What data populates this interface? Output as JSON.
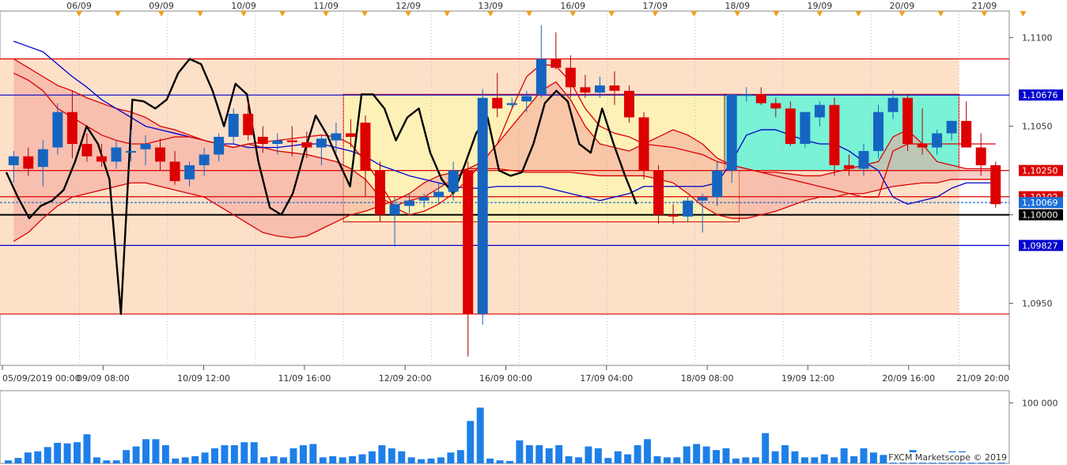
{
  "chart_data": {
    "type": "candlestick",
    "instrument_panel": {
      "top_date_ticks": [
        "06/09",
        "09/09",
        "10/09",
        "11/09",
        "12/09",
        "13/09",
        "16/09",
        "17/09",
        "18/09",
        "19/09",
        "20/09",
        "21/09"
      ],
      "bottom_time_ticks": [
        "05/09/2019 00:00",
        "09/09 08:00",
        "10/09 12:00",
        "11/09 16:00",
        "12/09 20:00",
        "16/09 00:00",
        "17/09 04:00",
        "18/09 08:00",
        "19/09 12:00",
        "20/09 16:00",
        "21/09 20:00"
      ],
      "y_ticks": [
        "1,0950",
        "1,1000",
        "1,1050",
        "1,1100"
      ],
      "ylim": [
        1.0915,
        1.1115
      ],
      "price_tags": [
        {
          "label": "1,10676",
          "value": 1.10676,
          "bg": "#0000cc",
          "fg": "#ffffff"
        },
        {
          "label": "1,10250",
          "value": 1.1025,
          "bg": "#dd0000",
          "fg": "#ffffff"
        },
        {
          "label": "1,10102",
          "value": 1.10102,
          "bg": "#dd0000",
          "fg": "#ffffff"
        },
        {
          "label": "1,10069",
          "value": 1.10069,
          "bg": "#1e6fd9",
          "fg": "#ffffff"
        },
        {
          "label": "1,10000",
          "value": 1.1,
          "bg": "#000000",
          "fg": "#ffffff"
        },
        {
          "label": "1,09827",
          "value": 1.09827,
          "bg": "#0000cc",
          "fg": "#ffffff"
        }
      ],
      "horizontal_lines": [
        {
          "value": 1.1088,
          "color": "#dd0000"
        },
        {
          "value": 1.10676,
          "color": "#0000cc"
        },
        {
          "value": 1.1025,
          "color": "#dd0000"
        },
        {
          "value": 1.10102,
          "color": "#dd0000"
        },
        {
          "value": 1.10069,
          "color": "#1e6fd9",
          "dashed": true
        },
        {
          "value": 1.1,
          "color": "#000000"
        },
        {
          "value": 1.09827,
          "color": "#0000cc"
        },
        {
          "value": 1.0944,
          "color": "#dd0000"
        }
      ],
      "zones": [
        {
          "from_bar": 0,
          "to_bar": 64,
          "low": 1.0944,
          "high": 1.1088,
          "color": "#fde0c8"
        },
        {
          "from_bar": 23,
          "to_bar": 49,
          "low": 1.0996,
          "high": 1.1068,
          "color": "#fdf1b8"
        },
        {
          "from_bar": 49,
          "to_bar": 64,
          "low": 1.1025,
          "high": 1.1068,
          "color": "#79f2d6"
        }
      ],
      "candles": [
        {
          "o": 1.1028,
          "h": 1.1036,
          "l": 1.1018,
          "c": 1.1033
        },
        {
          "o": 1.1033,
          "h": 1.1038,
          "l": 1.1022,
          "c": 1.1026
        },
        {
          "o": 1.1027,
          "h": 1.1042,
          "l": 1.1016,
          "c": 1.1037
        },
        {
          "o": 1.1038,
          "h": 1.1063,
          "l": 1.1034,
          "c": 1.1058
        },
        {
          "o": 1.1058,
          "h": 1.107,
          "l": 1.1032,
          "c": 1.104
        },
        {
          "o": 1.104,
          "h": 1.1046,
          "l": 1.103,
          "c": 1.1033
        },
        {
          "o": 1.1033,
          "h": 1.104,
          "l": 1.1027,
          "c": 1.103
        },
        {
          "o": 1.103,
          "h": 1.1042,
          "l": 1.1026,
          "c": 1.1038
        },
        {
          "o": 1.1036,
          "h": 1.1048,
          "l": 1.103,
          "c": 1.1036
        },
        {
          "o": 1.1037,
          "h": 1.1045,
          "l": 1.1028,
          "c": 1.104
        },
        {
          "o": 1.1038,
          "h": 1.1043,
          "l": 1.1025,
          "c": 1.103
        },
        {
          "o": 1.103,
          "h": 1.1036,
          "l": 1.1017,
          "c": 1.1019
        },
        {
          "o": 1.102,
          "h": 1.103,
          "l": 1.1016,
          "c": 1.1028
        },
        {
          "o": 1.1028,
          "h": 1.1038,
          "l": 1.1022,
          "c": 1.1034
        },
        {
          "o": 1.1034,
          "h": 1.1046,
          "l": 1.103,
          "c": 1.1044
        },
        {
          "o": 1.1044,
          "h": 1.106,
          "l": 1.104,
          "c": 1.1057
        },
        {
          "o": 1.1057,
          "h": 1.1064,
          "l": 1.1042,
          "c": 1.1045
        },
        {
          "o": 1.1044,
          "h": 1.105,
          "l": 1.1035,
          "c": 1.104
        },
        {
          "o": 1.104,
          "h": 1.1046,
          "l": 1.1034,
          "c": 1.1042
        },
        {
          "o": 1.1042,
          "h": 1.105,
          "l": 1.1033,
          "c": 1.1041
        },
        {
          "o": 1.1041,
          "h": 1.1047,
          "l": 1.1032,
          "c": 1.1038
        },
        {
          "o": 1.1038,
          "h": 1.1045,
          "l": 1.1028,
          "c": 1.1043
        },
        {
          "o": 1.1042,
          "h": 1.1052,
          "l": 1.1035,
          "c": 1.1046
        },
        {
          "o": 1.1046,
          "h": 1.1054,
          "l": 1.1038,
          "c": 1.1044
        },
        {
          "o": 1.1052,
          "h": 1.1056,
          "l": 1.101,
          "c": 1.1025
        },
        {
          "o": 1.1025,
          "h": 1.103,
          "l": 1.0996,
          "c": 1.1
        },
        {
          "o": 1.1,
          "h": 1.101,
          "l": 1.0982,
          "c": 1.1006
        },
        {
          "o": 1.1005,
          "h": 1.1012,
          "l": 1.1,
          "c": 1.1008
        },
        {
          "o": 1.1008,
          "h": 1.1012,
          "l": 1.1004,
          "c": 1.101
        },
        {
          "o": 1.101,
          "h": 1.1018,
          "l": 1.1006,
          "c": 1.1013
        },
        {
          "o": 1.1013,
          "h": 1.103,
          "l": 1.1008,
          "c": 1.1025
        },
        {
          "o": 1.1025,
          "h": 1.103,
          "l": 1.092,
          "c": 1.0944
        },
        {
          "o": 1.0944,
          "h": 1.1071,
          "l": 1.0938,
          "c": 1.1066
        },
        {
          "o": 1.1066,
          "h": 1.108,
          "l": 1.1055,
          "c": 1.106
        },
        {
          "o": 1.1062,
          "h": 1.1066,
          "l": 1.106,
          "c": 1.1063
        },
        {
          "o": 1.1064,
          "h": 1.107,
          "l": 1.1058,
          "c": 1.1067
        },
        {
          "o": 1.1068,
          "h": 1.1107,
          "l": 1.1066,
          "c": 1.1088
        },
        {
          "o": 1.1088,
          "h": 1.1103,
          "l": 1.1082,
          "c": 1.1083
        },
        {
          "o": 1.1083,
          "h": 1.109,
          "l": 1.1066,
          "c": 1.1072
        },
        {
          "o": 1.1072,
          "h": 1.1079,
          "l": 1.1066,
          "c": 1.1069
        },
        {
          "o": 1.1069,
          "h": 1.1078,
          "l": 1.1066,
          "c": 1.1073
        },
        {
          "o": 1.1073,
          "h": 1.1081,
          "l": 1.1062,
          "c": 1.107
        },
        {
          "o": 1.107,
          "h": 1.1073,
          "l": 1.1052,
          "c": 1.1055
        },
        {
          "o": 1.1055,
          "h": 1.1058,
          "l": 1.102,
          "c": 1.1025
        },
        {
          "o": 1.1025,
          "h": 1.1028,
          "l": 1.0995,
          "c": 1.1
        },
        {
          "o": 1.1,
          "h": 1.1006,
          "l": 1.0995,
          "c": 1.0999
        },
        {
          "o": 1.0999,
          "h": 1.101,
          "l": 1.0996,
          "c": 1.1008
        },
        {
          "o": 1.1008,
          "h": 1.1012,
          "l": 1.099,
          "c": 1.101
        },
        {
          "o": 1.101,
          "h": 1.103,
          "l": 1.1005,
          "c": 1.1025
        },
        {
          "o": 1.1025,
          "h": 1.103,
          "l": 1.1018,
          "c": 1.1068
        },
        {
          "o": 1.1068,
          "h": 1.1072,
          "l": 1.1064,
          "c": 1.1068
        },
        {
          "o": 1.1068,
          "h": 1.1072,
          "l": 1.1062,
          "c": 1.1063
        },
        {
          "o": 1.1063,
          "h": 1.1066,
          "l": 1.1055,
          "c": 1.106
        },
        {
          "o": 1.106,
          "h": 1.1064,
          "l": 1.1039,
          "c": 1.104
        },
        {
          "o": 1.104,
          "h": 1.1058,
          "l": 1.1038,
          "c": 1.1058
        },
        {
          "o": 1.1055,
          "h": 1.1064,
          "l": 1.105,
          "c": 1.1062
        },
        {
          "o": 1.1062,
          "h": 1.1066,
          "l": 1.1022,
          "c": 1.1028
        },
        {
          "o": 1.1028,
          "h": 1.1034,
          "l": 1.1022,
          "c": 1.1026
        },
        {
          "o": 1.1026,
          "h": 1.104,
          "l": 1.1022,
          "c": 1.1036
        },
        {
          "o": 1.1036,
          "h": 1.1062,
          "l": 1.1032,
          "c": 1.1058
        },
        {
          "o": 1.1058,
          "h": 1.107,
          "l": 1.1054,
          "c": 1.1066
        },
        {
          "o": 1.1066,
          "h": 1.1068,
          "l": 1.1036,
          "c": 1.104
        },
        {
          "o": 1.104,
          "h": 1.106,
          "l": 1.1034,
          "c": 1.1038
        },
        {
          "o": 1.1038,
          "h": 1.1048,
          "l": 1.1034,
          "c": 1.1046
        },
        {
          "o": 1.1046,
          "h": 1.1053,
          "l": 1.1042,
          "c": 1.1053
        },
        {
          "o": 1.1053,
          "h": 1.1064,
          "l": 1.104,
          "c": 1.1038
        },
        {
          "o": 1.1038,
          "h": 1.1046,
          "l": 1.1022,
          "c": 1.1028
        },
        {
          "o": 1.1028,
          "h": 1.103,
          "l": 1.1004,
          "c": 1.1006
        }
      ],
      "overlay_lines": {
        "black_oscillator": [
          1.1024,
          1.101,
          1.0998,
          1.1005,
          1.1008,
          1.1014,
          1.103,
          1.105,
          1.104,
          1.102,
          1.0944,
          1.1065,
          1.1064,
          1.106,
          1.1065,
          1.108,
          1.1088,
          1.1085,
          1.107,
          1.105,
          1.1074,
          1.1068,
          1.103,
          1.1004,
          1.1,
          1.1012,
          1.1035,
          1.1056,
          1.1045,
          1.103,
          1.1016,
          1.1068,
          1.1068,
          1.106,
          1.1042,
          1.1055,
          1.106,
          1.1035,
          1.102,
          1.1012,
          1.1028,
          1.1046,
          1.1055,
          1.1025,
          1.1022,
          1.1024,
          1.104,
          1.1063,
          1.107,
          1.1064,
          1.104,
          1.1035,
          1.106,
          1.104,
          1.1022,
          1.1006
        ],
        "red_cloud_upper": [
          1.1088,
          1.1083,
          1.1078,
          1.1073,
          1.107,
          1.1066,
          1.1063,
          1.106,
          1.1058,
          1.1055,
          1.105,
          1.1048,
          1.1045,
          1.1042,
          1.104,
          1.1038,
          1.104,
          1.1038,
          1.1036,
          1.1035,
          1.1034,
          1.1032,
          1.103,
          1.1026,
          1.102,
          1.101,
          1.1005,
          1.1008,
          1.101,
          1.1015,
          1.102,
          1.1026,
          1.103,
          1.104,
          1.105,
          1.106,
          1.107,
          1.1075,
          1.1065,
          1.105,
          1.104,
          1.1038,
          1.1036,
          1.104,
          1.1044,
          1.1048,
          1.1045,
          1.104,
          1.1032,
          1.1028,
          1.1026,
          1.1024,
          1.1024,
          1.1023,
          1.1022,
          1.1022,
          1.1024,
          1.1026,
          1.1028,
          1.103,
          1.1044,
          1.1048,
          1.104,
          1.103,
          1.1028,
          1.1026,
          1.1026,
          1.1026
        ],
        "red_cloud_lower": [
          1.0985,
          1.099,
          1.0998,
          1.1005,
          1.101,
          1.1012,
          1.1014,
          1.1016,
          1.1018,
          1.1018,
          1.1016,
          1.1014,
          1.1012,
          1.101,
          1.1005,
          1.1,
          1.0995,
          1.099,
          1.0988,
          1.0987,
          1.0988,
          1.0992,
          1.0996,
          1.1,
          1.1002,
          1.1005,
          1.1008,
          1.1012,
          1.1018,
          1.1022,
          1.1024,
          1.1026,
          1.1026,
          1.1026,
          1.1025,
          1.1024,
          1.1024,
          1.1024,
          1.1024,
          1.1023,
          1.1022,
          1.1022,
          1.1022,
          1.1022,
          1.102,
          1.1018,
          1.1012,
          1.1005,
          1.1,
          1.0998,
          1.0998,
          1.1,
          1.1002,
          1.1005,
          1.1008,
          1.101,
          1.101,
          1.1012,
          1.1012,
          1.1014,
          1.1016,
          1.1017,
          1.1018,
          1.1018,
          1.102,
          1.102,
          1.102,
          1.102
        ],
        "blue_kijun": [
          1.1098,
          1.1095,
          1.1092,
          1.1085,
          1.1078,
          1.1072,
          1.1065,
          1.106,
          1.1055,
          1.105,
          1.1048,
          1.1046,
          1.1044,
          1.1042,
          1.104,
          1.104,
          1.1038,
          1.1038,
          1.1038,
          1.1039,
          1.104,
          1.104,
          1.1038,
          1.1036,
          1.1033,
          1.1028,
          1.1025,
          1.1022,
          1.102,
          1.1018,
          1.1016,
          1.1015,
          1.1015,
          1.1016,
          1.1016,
          1.1016,
          1.1016,
          1.1014,
          1.1012,
          1.101,
          1.1008,
          1.101,
          1.1012,
          1.1016,
          1.1016,
          1.1016,
          1.1016,
          1.1016,
          1.1018,
          1.103,
          1.1045,
          1.1048,
          1.1048,
          1.1045,
          1.1042,
          1.104,
          1.104,
          1.1036,
          1.103,
          1.1025,
          1.101,
          1.1006,
          1.1008,
          1.101,
          1.1015,
          1.1018,
          1.1018,
          1.1018
        ],
        "red_tenkan": [
          1.108,
          1.1076,
          1.107,
          1.106,
          1.1055,
          1.105,
          1.1045,
          1.1042,
          1.104,
          1.104,
          1.1042,
          1.1044,
          1.1044,
          1.1042,
          1.104,
          1.1038,
          1.104,
          1.1041,
          1.1042,
          1.1043,
          1.1044,
          1.1045,
          1.1044,
          1.104,
          1.103,
          1.1018,
          1.1004,
          1.1,
          1.1002,
          1.1006,
          1.1012,
          1.102,
          1.103,
          1.104,
          1.106,
          1.1078,
          1.1085,
          1.1084,
          1.1075,
          1.106,
          1.105,
          1.1046,
          1.1044,
          1.104,
          1.1039,
          1.1038,
          1.1036,
          1.1034,
          1.103,
          1.1028,
          1.1026,
          1.1024,
          1.1022,
          1.102,
          1.1018,
          1.1016,
          1.1014,
          1.1012,
          1.101,
          1.101,
          1.1036,
          1.104,
          1.104,
          1.104,
          1.104,
          1.104,
          1.104,
          1.104
        ]
      }
    },
    "volume_panel": {
      "y_ticks": [
        "100 000"
      ],
      "ylim": [
        0,
        120000
      ],
      "volumes": [
        5000,
        9000,
        18000,
        20000,
        27000,
        34000,
        33000,
        35000,
        48000,
        10000,
        5000,
        5000,
        22000,
        28000,
        40000,
        40000,
        30000,
        8000,
        10000,
        12000,
        18000,
        25000,
        30000,
        30000,
        35000,
        35000,
        10000,
        12000,
        10000,
        25000,
        30000,
        32000,
        10000,
        12000,
        10000,
        12000,
        15000,
        20000,
        30000,
        25000,
        20000,
        10000,
        7000,
        8000,
        10000,
        18000,
        22000,
        70000,
        92000,
        8000,
        5000,
        4000,
        38000,
        30000,
        30000,
        25000,
        30000,
        12000,
        10000,
        28000,
        25000,
        9000,
        20000,
        15000,
        30000,
        40000,
        12000,
        10000,
        10000,
        28000,
        32000,
        28000,
        22000,
        25000,
        8000,
        10000,
        10000,
        50000,
        20000,
        30000,
        20000,
        10000,
        10000,
        15000,
        10000,
        25000,
        12000,
        25000,
        18000,
        14000,
        8000,
        16000,
        22000,
        18000,
        10000,
        10000,
        20000,
        20000,
        18000,
        15000,
        14000,
        12000
      ]
    },
    "credit": "FXCM Marketscope © 2019"
  }
}
